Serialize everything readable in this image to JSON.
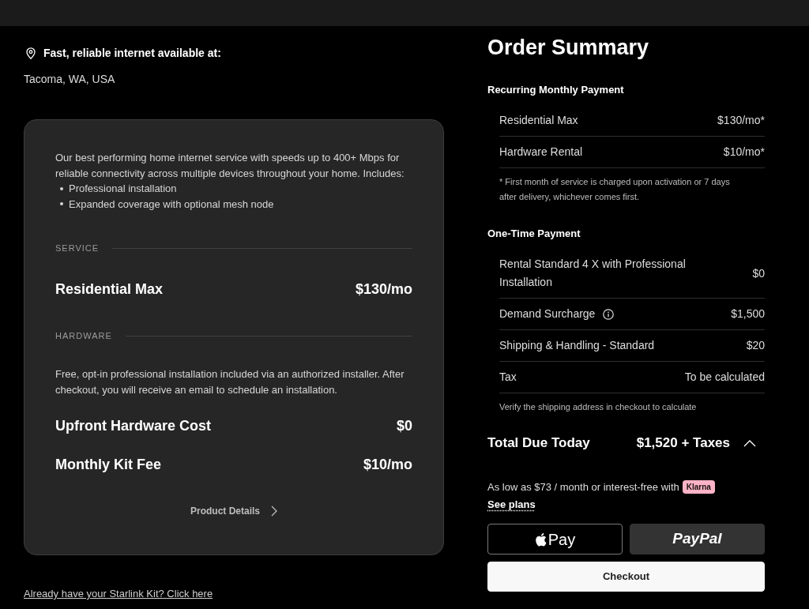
{
  "location": {
    "heading": "Fast, reliable internet available at:",
    "address": "Tacoma, WA, USA"
  },
  "plan_card": {
    "description": "Our best performing home internet service with speeds up to 400+ Mbps for reliable connectivity across multiple devices throughout your home. Includes:",
    "features": [
      "Professional installation",
      "Expanded coverage with optional mesh node"
    ],
    "sections": [
      {
        "label": "SERVICE",
        "lines": [
          {
            "name": "Residential Max",
            "price": "$130/mo"
          }
        ]
      },
      {
        "label": "HARDWARE",
        "note": "Free, opt-in professional installation included via an authorized installer. After checkout, you will receive an email to schedule an installation.",
        "lines": [
          {
            "name": "Upfront Hardware Cost",
            "price": "$0"
          },
          {
            "name": "Monthly Kit Fee",
            "price": "$10/mo"
          }
        ]
      }
    ],
    "details_link": "Product Details"
  },
  "kit_link": "Already have your Starlink Kit? Click here",
  "order_summary": {
    "title": "Order Summary",
    "groups": [
      {
        "heading": "Recurring Monthly Payment",
        "rows": [
          {
            "label": "Residential Max",
            "amount": "$130/mo*",
            "info": false
          },
          {
            "label": "Hardware Rental",
            "amount": "$10/mo*",
            "info": false
          }
        ],
        "note": "* First month of service is charged upon activation or 7 days after delivery, whichever comes first."
      },
      {
        "heading": "One-Time Payment",
        "rows": [
          {
            "label": "Rental Standard 4 X with Professional Installation",
            "amount": "$0",
            "info": false
          },
          {
            "label": "Demand Surcharge",
            "amount": "$1,500",
            "info": true
          },
          {
            "label": "Shipping & Handling - Standard",
            "amount": "$20",
            "info": false
          },
          {
            "label": "Tax",
            "amount": "To be calculated",
            "info": false
          }
        ],
        "note": "Verify the shipping address in checkout to calculate"
      }
    ],
    "total": {
      "label": "Total Due Today",
      "amount": "$1,520 + Taxes",
      "expanded": true
    },
    "financing": {
      "text": "As low as $73 / month or interest-free with",
      "badge": "Klarna",
      "link": "See plans"
    },
    "buttons": [
      {
        "kind": "apple_pay",
        "label": "Pay"
      },
      {
        "kind": "paypal",
        "label": "PayPal"
      },
      {
        "kind": "checkout",
        "label": "Checkout"
      }
    ]
  }
}
